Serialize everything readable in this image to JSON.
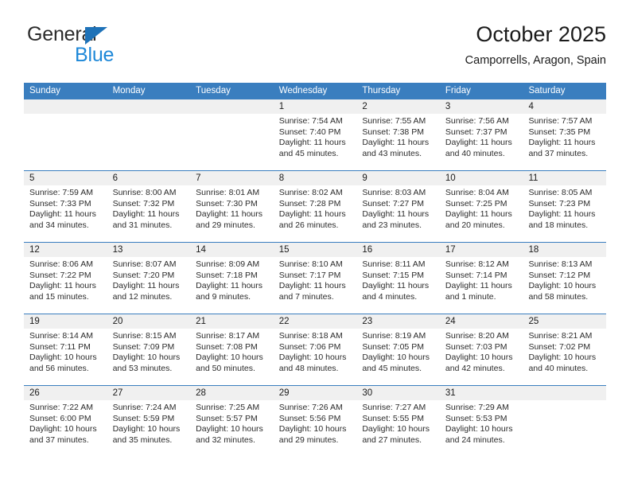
{
  "logo": {
    "word1": "General",
    "word2": "Blue",
    "accent_color": "#1e88d8",
    "triangle_color": "#1e72b8"
  },
  "header": {
    "title": "October 2025",
    "subtitle": "Camporrells, Aragon, Spain"
  },
  "theme": {
    "header_blue": "#3a7ebf",
    "daynum_bg": "#f0f0f0",
    "cell_bg": "#ffffff",
    "text": "#2b2b2b"
  },
  "weekdays": [
    "Sunday",
    "Monday",
    "Tuesday",
    "Wednesday",
    "Thursday",
    "Friday",
    "Saturday"
  ],
  "weeks": [
    [
      {
        "day": "",
        "lines": [
          "",
          "",
          "",
          ""
        ]
      },
      {
        "day": "",
        "lines": [
          "",
          "",
          "",
          ""
        ]
      },
      {
        "day": "",
        "lines": [
          "",
          "",
          "",
          ""
        ]
      },
      {
        "day": "1",
        "lines": [
          "Sunrise: 7:54 AM",
          "Sunset: 7:40 PM",
          "Daylight: 11 hours",
          "and 45 minutes."
        ]
      },
      {
        "day": "2",
        "lines": [
          "Sunrise: 7:55 AM",
          "Sunset: 7:38 PM",
          "Daylight: 11 hours",
          "and 43 minutes."
        ]
      },
      {
        "day": "3",
        "lines": [
          "Sunrise: 7:56 AM",
          "Sunset: 7:37 PM",
          "Daylight: 11 hours",
          "and 40 minutes."
        ]
      },
      {
        "day": "4",
        "lines": [
          "Sunrise: 7:57 AM",
          "Sunset: 7:35 PM",
          "Daylight: 11 hours",
          "and 37 minutes."
        ]
      }
    ],
    [
      {
        "day": "5",
        "lines": [
          "Sunrise: 7:59 AM",
          "Sunset: 7:33 PM",
          "Daylight: 11 hours",
          "and 34 minutes."
        ]
      },
      {
        "day": "6",
        "lines": [
          "Sunrise: 8:00 AM",
          "Sunset: 7:32 PM",
          "Daylight: 11 hours",
          "and 31 minutes."
        ]
      },
      {
        "day": "7",
        "lines": [
          "Sunrise: 8:01 AM",
          "Sunset: 7:30 PM",
          "Daylight: 11 hours",
          "and 29 minutes."
        ]
      },
      {
        "day": "8",
        "lines": [
          "Sunrise: 8:02 AM",
          "Sunset: 7:28 PM",
          "Daylight: 11 hours",
          "and 26 minutes."
        ]
      },
      {
        "day": "9",
        "lines": [
          "Sunrise: 8:03 AM",
          "Sunset: 7:27 PM",
          "Daylight: 11 hours",
          "and 23 minutes."
        ]
      },
      {
        "day": "10",
        "lines": [
          "Sunrise: 8:04 AM",
          "Sunset: 7:25 PM",
          "Daylight: 11 hours",
          "and 20 minutes."
        ]
      },
      {
        "day": "11",
        "lines": [
          "Sunrise: 8:05 AM",
          "Sunset: 7:23 PM",
          "Daylight: 11 hours",
          "and 18 minutes."
        ]
      }
    ],
    [
      {
        "day": "12",
        "lines": [
          "Sunrise: 8:06 AM",
          "Sunset: 7:22 PM",
          "Daylight: 11 hours",
          "and 15 minutes."
        ]
      },
      {
        "day": "13",
        "lines": [
          "Sunrise: 8:07 AM",
          "Sunset: 7:20 PM",
          "Daylight: 11 hours",
          "and 12 minutes."
        ]
      },
      {
        "day": "14",
        "lines": [
          "Sunrise: 8:09 AM",
          "Sunset: 7:18 PM",
          "Daylight: 11 hours",
          "and 9 minutes."
        ]
      },
      {
        "day": "15",
        "lines": [
          "Sunrise: 8:10 AM",
          "Sunset: 7:17 PM",
          "Daylight: 11 hours",
          "and 7 minutes."
        ]
      },
      {
        "day": "16",
        "lines": [
          "Sunrise: 8:11 AM",
          "Sunset: 7:15 PM",
          "Daylight: 11 hours",
          "and 4 minutes."
        ]
      },
      {
        "day": "17",
        "lines": [
          "Sunrise: 8:12 AM",
          "Sunset: 7:14 PM",
          "Daylight: 11 hours",
          "and 1 minute."
        ]
      },
      {
        "day": "18",
        "lines": [
          "Sunrise: 8:13 AM",
          "Sunset: 7:12 PM",
          "Daylight: 10 hours",
          "and 58 minutes."
        ]
      }
    ],
    [
      {
        "day": "19",
        "lines": [
          "Sunrise: 8:14 AM",
          "Sunset: 7:11 PM",
          "Daylight: 10 hours",
          "and 56 minutes."
        ]
      },
      {
        "day": "20",
        "lines": [
          "Sunrise: 8:15 AM",
          "Sunset: 7:09 PM",
          "Daylight: 10 hours",
          "and 53 minutes."
        ]
      },
      {
        "day": "21",
        "lines": [
          "Sunrise: 8:17 AM",
          "Sunset: 7:08 PM",
          "Daylight: 10 hours",
          "and 50 minutes."
        ]
      },
      {
        "day": "22",
        "lines": [
          "Sunrise: 8:18 AM",
          "Sunset: 7:06 PM",
          "Daylight: 10 hours",
          "and 48 minutes."
        ]
      },
      {
        "day": "23",
        "lines": [
          "Sunrise: 8:19 AM",
          "Sunset: 7:05 PM",
          "Daylight: 10 hours",
          "and 45 minutes."
        ]
      },
      {
        "day": "24",
        "lines": [
          "Sunrise: 8:20 AM",
          "Sunset: 7:03 PM",
          "Daylight: 10 hours",
          "and 42 minutes."
        ]
      },
      {
        "day": "25",
        "lines": [
          "Sunrise: 8:21 AM",
          "Sunset: 7:02 PM",
          "Daylight: 10 hours",
          "and 40 minutes."
        ]
      }
    ],
    [
      {
        "day": "26",
        "lines": [
          "Sunrise: 7:22 AM",
          "Sunset: 6:00 PM",
          "Daylight: 10 hours",
          "and 37 minutes."
        ]
      },
      {
        "day": "27",
        "lines": [
          "Sunrise: 7:24 AM",
          "Sunset: 5:59 PM",
          "Daylight: 10 hours",
          "and 35 minutes."
        ]
      },
      {
        "day": "28",
        "lines": [
          "Sunrise: 7:25 AM",
          "Sunset: 5:57 PM",
          "Daylight: 10 hours",
          "and 32 minutes."
        ]
      },
      {
        "day": "29",
        "lines": [
          "Sunrise: 7:26 AM",
          "Sunset: 5:56 PM",
          "Daylight: 10 hours",
          "and 29 minutes."
        ]
      },
      {
        "day": "30",
        "lines": [
          "Sunrise: 7:27 AM",
          "Sunset: 5:55 PM",
          "Daylight: 10 hours",
          "and 27 minutes."
        ]
      },
      {
        "day": "31",
        "lines": [
          "Sunrise: 7:29 AM",
          "Sunset: 5:53 PM",
          "Daylight: 10 hours",
          "and 24 minutes."
        ]
      },
      {
        "day": "",
        "lines": [
          "",
          "",
          "",
          ""
        ]
      }
    ]
  ]
}
